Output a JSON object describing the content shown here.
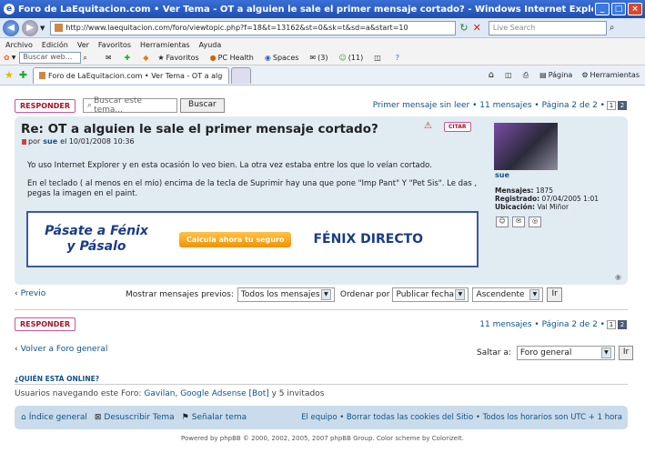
{
  "window": {
    "title": "Foro de LaEquitacion.com • Ver Tema - OT a alguien le sale el primer mensaje cortado? - Windows Internet Explorer",
    "url": "http://www.laequitacion.com/foro/viewtopic.php?f=18&t=13162&st=0&sk=t&sd=a&start=10",
    "search_placeholder": "Live Search"
  },
  "menu": [
    "Archivo",
    "Edición",
    "Ver",
    "Favoritos",
    "Herramientas",
    "Ayuda"
  ],
  "links_bar": {
    "search_placeholder": "Buscar web...",
    "favoritos": "Favoritos",
    "pc_health": "PC Health",
    "spaces": "Spaces",
    "mail_count": "(3)",
    "contacts_count": "(11)"
  },
  "tab": {
    "label": "Foro de LaEquitacion.com • Ver Tema - OT a alguien l..."
  },
  "tools": {
    "pagina": "Página",
    "herramientas": "Herramientas"
  },
  "topic": {
    "reply_label": "RESPONDER",
    "search_placeholder": "Buscar este tema...",
    "search_button": "Buscar",
    "pagination_text": "Primer mensaje sin leer • 11 mensajes • Página 2 de 2 •",
    "pages": [
      "1",
      "2"
    ]
  },
  "post": {
    "title": "Re: OT a alguien le sale el primer mensaje cortado?",
    "quote_label": "CITAR",
    "byline_prefix": "por",
    "author": "sue",
    "date": "el 10/01/2008 10:36",
    "paragraph1": "Yo uso Internet Explorer y en esta ocasión lo veo bien. La otra vez estaba entre los que lo veían cortado.",
    "paragraph2a": "En el teclado ( al menos en el mío) encima de la tecla de Suprimir hay una que pone \"Imp Pant\" Y \"Pet Sis\". Le das , copi",
    "paragraph2b": "pegas la imagen en el paint.",
    "ad_left_1": "Pásate a Fénix",
    "ad_left_2": "y Pásalo",
    "ad_button": "Calcula ahora tu seguro",
    "ad_brand": "FÉNIX DIRECTO"
  },
  "profile": {
    "username": "sue",
    "mensajes_label": "Mensajes:",
    "mensajes_value": "1875",
    "registrado_label": "Registrado:",
    "registrado_value": "07/04/2005 1:01",
    "ubicacion_label": "Ubicación:",
    "ubicacion_value": "Val Miñor"
  },
  "sort_bar": {
    "previous": "Previo",
    "show_label": "Mostrar mensajes previos:",
    "show_value": "Todos los mensajes",
    "order_label": "Ordenar por",
    "order_value": "Publicar fecha",
    "direction_value": "Ascendente",
    "go": "Ir"
  },
  "bottom": {
    "reply_label": "RESPONDER",
    "pagination_text": "11 mensajes • Página 2 de 2 •",
    "back_link": "Volver a Foro general",
    "jump_label": "Saltar a:",
    "jump_value": "Foro general",
    "go": "Ir"
  },
  "online": {
    "heading": "¿QUIÉN ESTÁ ONLINE?",
    "text_prefix": "Usuarios navegando este Foro:",
    "user1": "Gavilan",
    "user2": "Google Adsense [Bot]",
    "text_suffix": "y 5 invitados"
  },
  "footer_nav": {
    "index": "Índice general",
    "unsubscribe": "Desuscribir Tema",
    "report": "Señalar tema",
    "right": "El equipo • Borrar todas las cookies del Sitio • Todos los horarios son UTC + 1 hora"
  },
  "copyright": "Powered by phpBB © 2000, 2002, 2005, 2007 phpBB Group. Color scheme by ColorizeIt."
}
